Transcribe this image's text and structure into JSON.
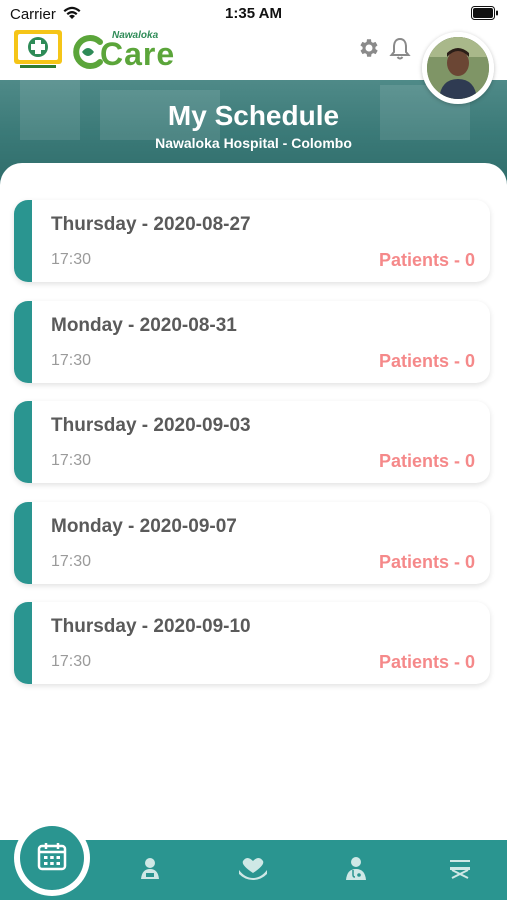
{
  "status_bar": {
    "carrier": "Carrier",
    "time": "1:35 AM"
  },
  "header": {
    "brand_small": "Nawaloka",
    "brand_big": "Care",
    "hospital_logo_icon": "nawaloka-hospital-logo",
    "settings_icon": "gear-icon",
    "notification_icon": "bell-icon"
  },
  "banner": {
    "title": "My Schedule",
    "subtitle": "Nawaloka Hospital - Colombo"
  },
  "schedule": [
    {
      "day": "Thursday  -  2020-08-27",
      "time": "17:30",
      "patients": "Patients  -  0"
    },
    {
      "day": "Monday  -  2020-08-31",
      "time": "17:30",
      "patients": "Patients  -  0"
    },
    {
      "day": "Thursday  -  2020-09-03",
      "time": "17:30",
      "patients": "Patients  -  0"
    },
    {
      "day": "Monday  -  2020-09-07",
      "time": "17:30",
      "patients": "Patients  -  0"
    },
    {
      "day": "Thursday  -  2020-09-10",
      "time": "17:30",
      "patients": "Patients  -  0"
    }
  ],
  "bottom_nav": [
    {
      "icon": "calendar-icon",
      "active": true
    },
    {
      "icon": "patient-icon",
      "active": false
    },
    {
      "icon": "care-hands-icon",
      "active": false
    },
    {
      "icon": "doctor-icon",
      "active": false
    },
    {
      "icon": "bed-icon",
      "active": false
    }
  ],
  "colors": {
    "primary": "#2a9590",
    "accent_text": "#f5898a",
    "brand_green": "#5ba53a"
  }
}
